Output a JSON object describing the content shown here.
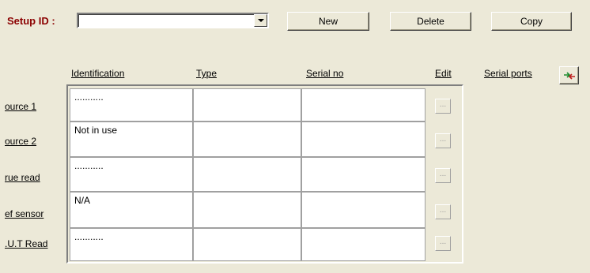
{
  "toolbar": {
    "setup_label": "Setup ID :",
    "setup_value": "",
    "new_label": "New",
    "delete_label": "Delete",
    "copy_label": "Copy"
  },
  "columns": {
    "identification": "Identification",
    "type": "Type",
    "serial_no": "Serial no",
    "edit": "Edit",
    "serial_ports": "Serial ports"
  },
  "rows": [
    {
      "label": "ource 1",
      "identification": "...........",
      "type": "",
      "serial": "",
      "edit": "..."
    },
    {
      "label": "ource 2",
      "identification": "Not in use",
      "type": "",
      "serial": "",
      "edit": "..."
    },
    {
      "label": "rue read",
      "identification": "...........",
      "type": "",
      "serial": "",
      "edit": "..."
    },
    {
      "label": "ef sensor",
      "identification": "N/A",
      "type": "",
      "serial": "",
      "edit": "..."
    },
    {
      "label": ".U.T Read",
      "identification": "...........",
      "type": "",
      "serial": "",
      "edit": "..."
    }
  ],
  "icons": {
    "refresh": "refresh-icon",
    "dropdown": "chevron-down-icon"
  },
  "colors": {
    "background": "#ECE9D8",
    "label_accent": "#8B0000",
    "icon_green": "#1E8C2E",
    "icon_red": "#C02020"
  }
}
